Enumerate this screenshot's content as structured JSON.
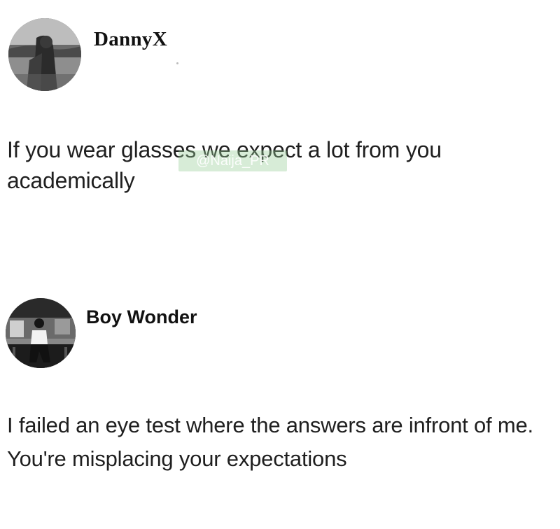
{
  "posts": [
    {
      "username": "DannyX",
      "text": "If you wear glasses we expect a lot from you academically",
      "watermark": "@Naija_PR"
    },
    {
      "username": "Boy Wonder",
      "text": "I failed an eye test where the answers are infront of me. You're misplacing your expectations"
    }
  ]
}
